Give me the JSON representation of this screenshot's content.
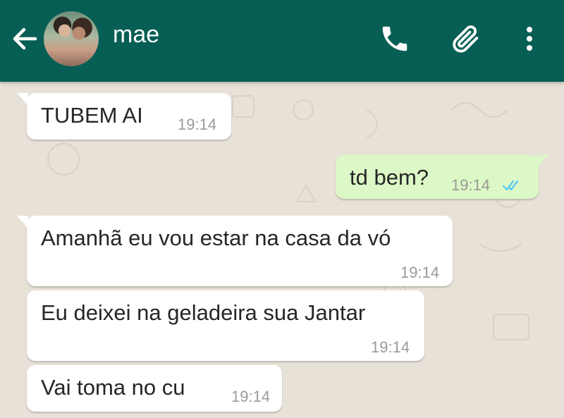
{
  "header": {
    "contact_name": "mae",
    "back_icon": "arrow-left-icon",
    "call_icon": "phone-icon",
    "attach_icon": "paperclip-icon",
    "menu_icon": "more-vertical-icon",
    "background_color": "#075e54"
  },
  "messages": [
    {
      "direction": "incoming",
      "text": "TUBEM AI",
      "time": "19:14"
    },
    {
      "direction": "outgoing",
      "text": "td bem?",
      "time": "19:14",
      "status": "read"
    },
    {
      "direction": "incoming",
      "text": "Amanhã eu vou estar na casa da vó",
      "time": "19:14"
    },
    {
      "direction": "incoming",
      "text": "Eu deixei na geladeira sua Jantar",
      "time": "19:14"
    },
    {
      "direction": "incoming",
      "text": "Vai toma no cu",
      "time": "19:14"
    }
  ],
  "colors": {
    "incoming_bubble": "#ffffff",
    "outgoing_bubble": "#dcf8c6",
    "read_ticks": "#4fc3f7",
    "chat_background": "#e7e1d8"
  }
}
